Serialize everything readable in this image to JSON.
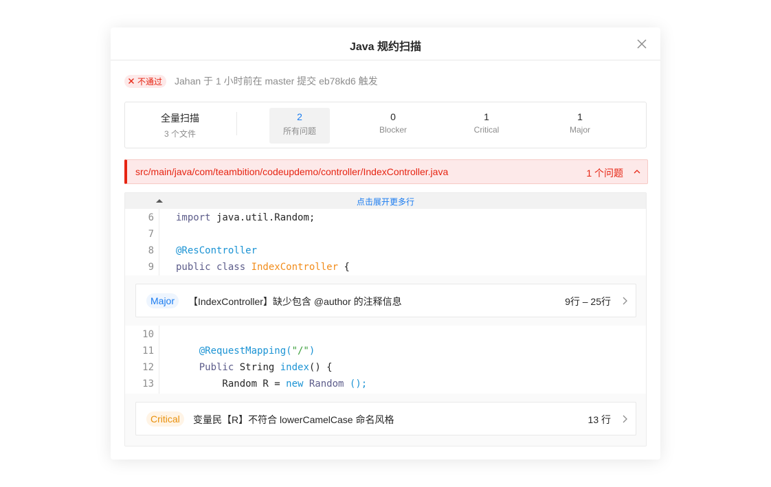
{
  "modal": {
    "title": "Java 规约扫描"
  },
  "status": {
    "badge": "不通过",
    "text": "Jahan 于 1 小时前在 master 提交 eb78kd6 触发"
  },
  "stats": {
    "scan_label": "全量扫描",
    "scan_files": "3 个文件",
    "items": [
      {
        "value": "2",
        "label": "所有问题"
      },
      {
        "value": "0",
        "label": "Blocker"
      },
      {
        "value": "1",
        "label": "Critical"
      },
      {
        "value": "1",
        "label": "Major"
      }
    ]
  },
  "file": {
    "path": "src/main/java/com/teambition/codeupdemo/controller/IndexController.java",
    "issue_count": "1 个问题"
  },
  "code": {
    "expand_label": "点击展开更多行",
    "block1": [
      {
        "ln": "6",
        "tokens": [
          [
            "kw",
            "import"
          ],
          [
            "",
            " java.util.Random;"
          ]
        ]
      },
      {
        "ln": "7",
        "tokens": []
      },
      {
        "ln": "8",
        "tokens": [
          [
            "ann",
            "@ResController"
          ]
        ]
      },
      {
        "ln": "9",
        "tokens": [
          [
            "kw",
            "public class "
          ],
          [
            "cls",
            "IndexController"
          ],
          [
            "",
            " {"
          ]
        ]
      }
    ],
    "block2": [
      {
        "ln": "10",
        "tokens": []
      },
      {
        "ln": "11",
        "tokens": [
          [
            "",
            "    "
          ],
          [
            "ann",
            "@RequestMapping("
          ],
          [
            "str",
            "\"/\""
          ],
          [
            "ann",
            ")"
          ]
        ]
      },
      {
        "ln": "12",
        "tokens": [
          [
            "",
            "    "
          ],
          [
            "kw",
            "Public"
          ],
          [
            "",
            " String "
          ],
          [
            "fn",
            "index"
          ],
          [
            "",
            "() {"
          ]
        ]
      },
      {
        "ln": "13",
        "tokens": [
          [
            "",
            "        Random R = "
          ],
          [
            "nw",
            "new"
          ],
          [
            "kw",
            " Random"
          ],
          [
            "nw",
            " ();"
          ]
        ]
      }
    ]
  },
  "issues": [
    {
      "severity": "Major",
      "message": "【IndexController】缺少包含 @author 的注释信息",
      "lines": "9行 – 25行"
    },
    {
      "severity": "Critical",
      "message": "变量民【R】不符合 lowerCamelCase 命名风格",
      "lines": "13 行"
    }
  ],
  "colors": {
    "accent": "#1b7cf0",
    "error": "#e62412",
    "warning": "#e8900c"
  }
}
